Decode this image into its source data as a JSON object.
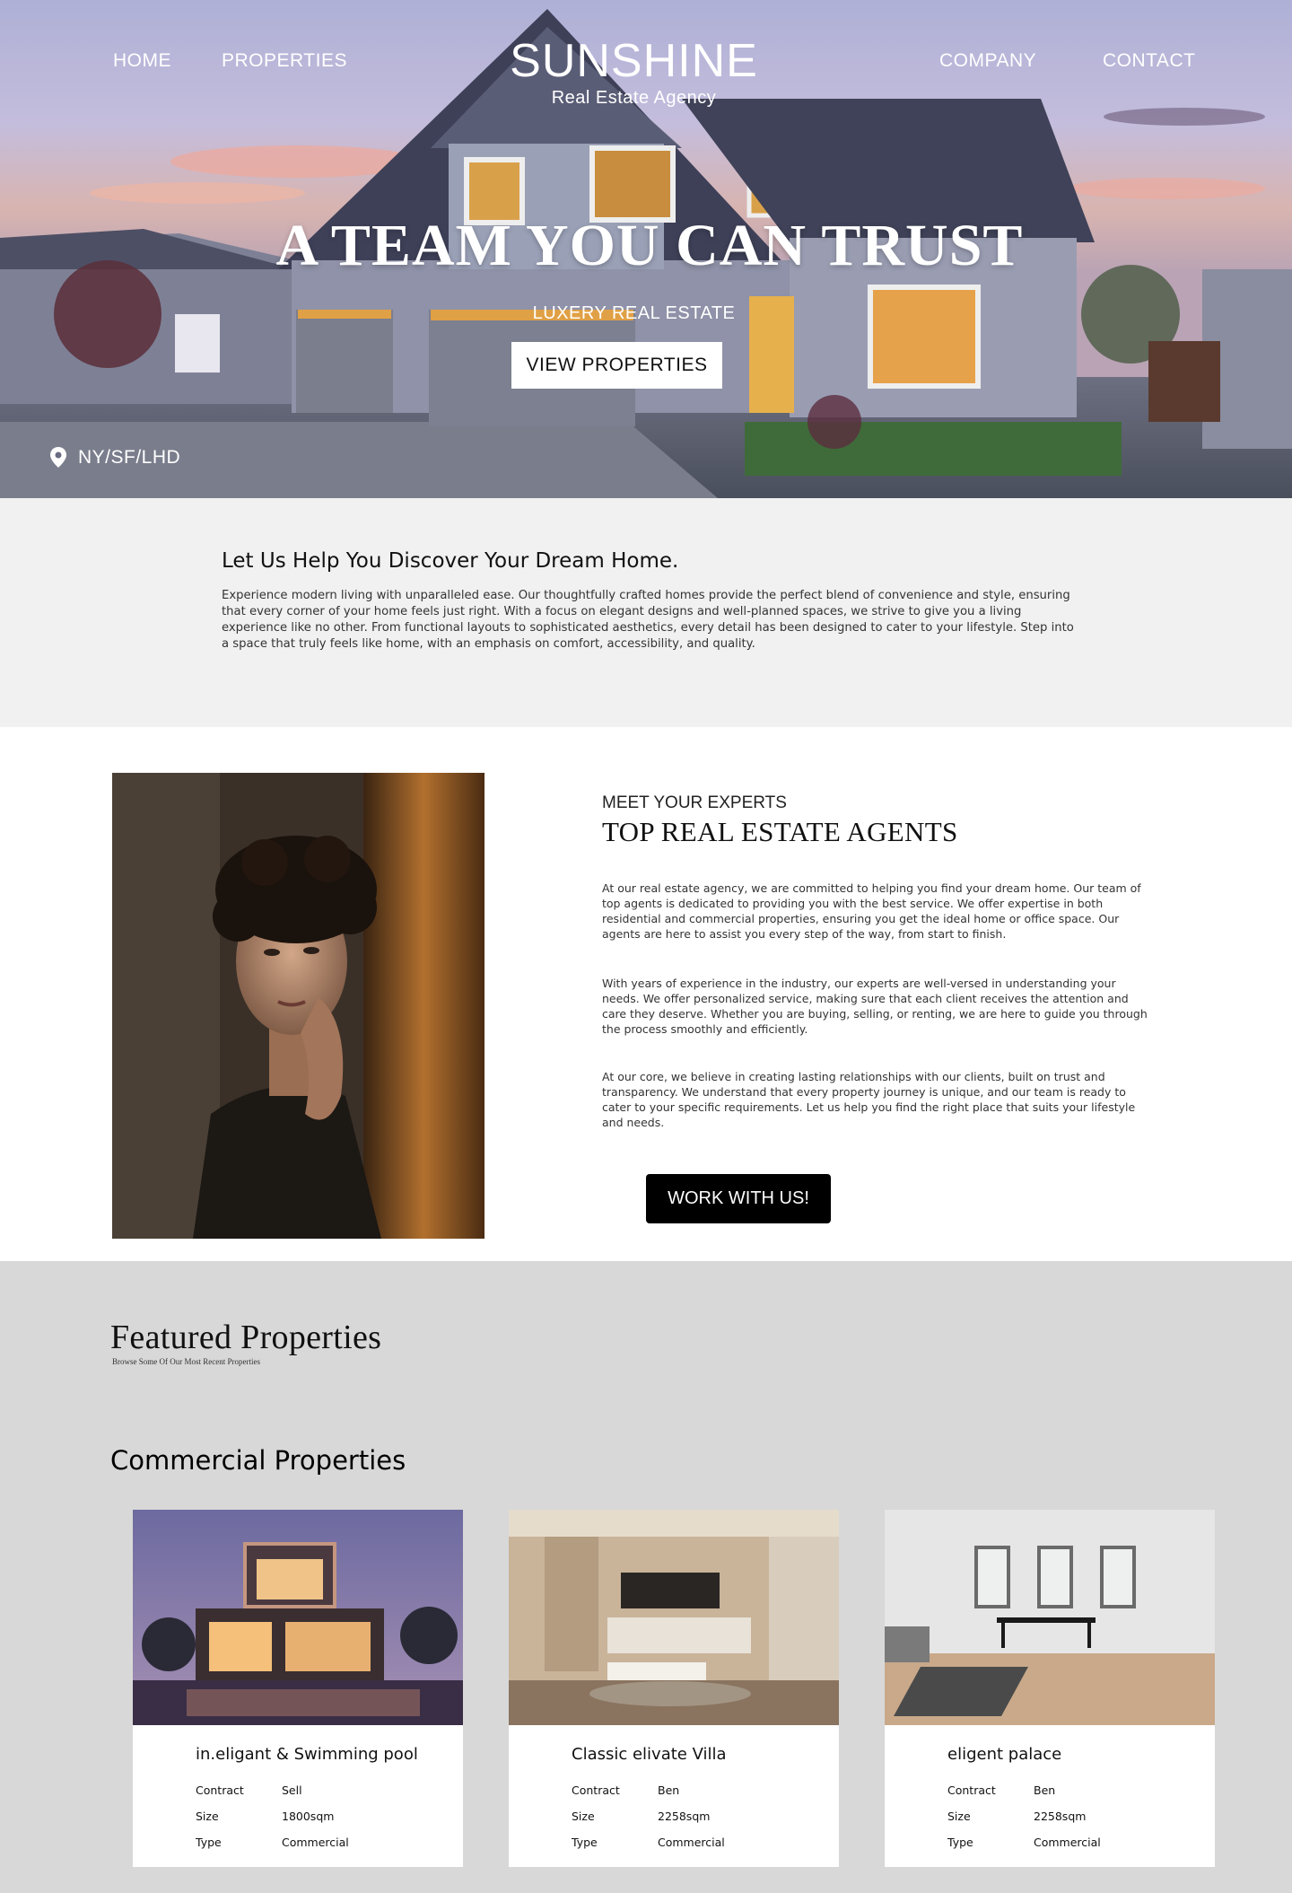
{
  "nav": {
    "home": "HOME",
    "properties": "PROPERTIES",
    "company": "COMPANY",
    "contact": "CONTACT"
  },
  "brand": {
    "name": "SUNSHINE",
    "tagline": "Real Estate Agency"
  },
  "hero": {
    "title": "A TEAM YOU CAN TRUST",
    "subtitle": "LUXERY REAL ESTATE",
    "button": "VIEW PROPERTIES",
    "location": "NY/SF/LHD",
    "location_icon": "map-pin-icon"
  },
  "discover": {
    "heading": "Let Us Help You Discover Your Dream Home.",
    "body": "Experience modern living with unparalleled ease. Our thoughtfully crafted homes provide the perfect blend of convenience and style, ensuring that every corner of your home feels just right. With a focus on elegant designs and well-planned spaces, we strive to give you a living experience like no other. From functional layouts to sophisticated aesthetics, every detail has been designed to cater to your lifestyle. Step into a space that truly feels like home, with an emphasis on comfort, accessibility, and quality."
  },
  "agents": {
    "eyebrow": "MEET YOUR EXPERTS",
    "heading": "TOP REAL ESTATE AGENTS",
    "paragraphs": [
      "At our real estate agency, we are committed to helping you find your dream home. Our team of top agents is dedicated to providing you with the best service. We offer expertise in both residential and commercial properties, ensuring you get the ideal home or office space. Our agents are here to assist you every step of the way, from start to finish.",
      "With years of experience in the industry, our experts are well-versed in understanding your needs. We offer personalized service, making sure that each client receives the attention and care they deserve. Whether you are buying, selling, or renting, we are here to guide you through the process smoothly and efficiently.",
      "At our core, we believe in creating lasting relationships with our clients, built on trust and transparency. We understand that every property journey is unique, and our team is ready to cater to your specific requirements. Let us help you find the right place that suits your lifestyle and needs."
    ],
    "button": "WORK WITH US!"
  },
  "featured": {
    "heading": "Featured Properties",
    "subheading": "Browse Some Of Our Most Recent Properties",
    "category": "Commercial Properties",
    "labels": {
      "contract": "Contract",
      "size": "Size",
      "type": "Type"
    },
    "cards": [
      {
        "title": "in.eligant & Swimming pool",
        "contract": "Sell",
        "size": "1800sqm",
        "type": "Commercial"
      },
      {
        "title": "Classic elivate Villa",
        "contract": "Ben",
        "size": "2258sqm",
        "type": "Commercial"
      },
      {
        "title": "eligent palace",
        "contract": "Ben",
        "size": "2258sqm",
        "type": "Commercial"
      }
    ]
  },
  "colors": {
    "discover_bg": "#f1f1f1",
    "featured_bg": "#d8d8d8",
    "button_dark": "#000000"
  }
}
